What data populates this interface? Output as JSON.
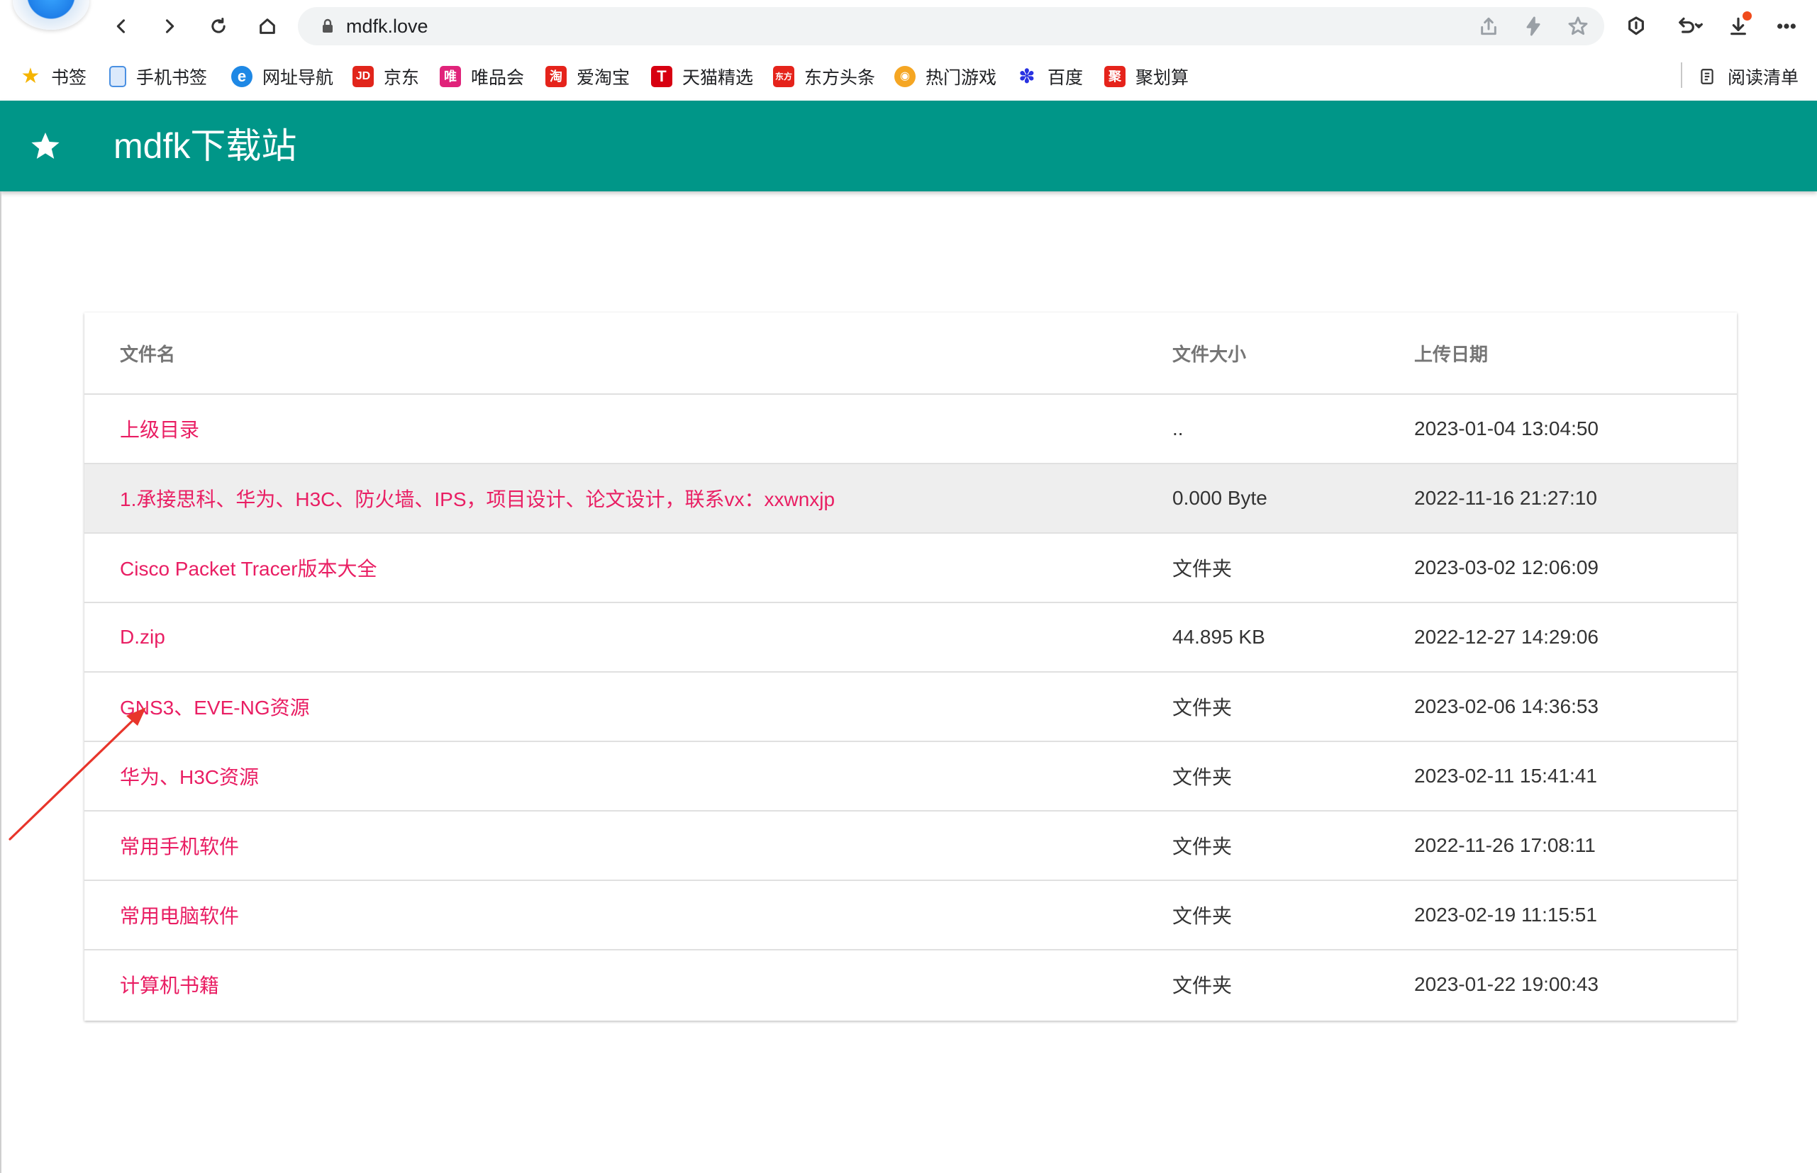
{
  "browser": {
    "url": "mdfk.love"
  },
  "bookmarks": [
    {
      "label": "书签",
      "icon": "star-icon",
      "color": "#f5b400",
      "glyph": "★"
    },
    {
      "label": "手机书签",
      "icon": "phone-icon",
      "color": "#4a90e2",
      "glyph": "▯"
    },
    {
      "label": "网址导航",
      "icon": "e-icon",
      "color": "#1e88e5",
      "glyph": "e"
    },
    {
      "label": "京东",
      "icon": "jd-icon",
      "color": "#e1251b",
      "glyph": "JD"
    },
    {
      "label": "唯品会",
      "icon": "vip-icon",
      "color": "#e0237a",
      "glyph": "唯"
    },
    {
      "label": "爱淘宝",
      "icon": "taobao-icon",
      "color": "#e5231b",
      "glyph": "淘"
    },
    {
      "label": "天猫精选",
      "icon": "tmall-icon",
      "color": "#d70011",
      "glyph": "T"
    },
    {
      "label": "东方头条",
      "icon": "toutiao-icon",
      "color": "#e5231b",
      "glyph": "东方"
    },
    {
      "label": "热门游戏",
      "icon": "game-icon",
      "color": "#f5a623",
      "glyph": "◉"
    },
    {
      "label": "百度",
      "icon": "baidu-paw-icon",
      "color": "#2932e1",
      "glyph": "✽"
    },
    {
      "label": "聚划算",
      "icon": "juhuasuan-icon",
      "color": "#e5231b",
      "glyph": "聚"
    }
  ],
  "reading_list": {
    "label": "阅读清单"
  },
  "site": {
    "title": "mdfk下载站",
    "header_color": "#009688"
  },
  "table": {
    "columns": [
      "文件名",
      "文件大小",
      "上传日期"
    ],
    "rows": [
      {
        "name": "上级目录",
        "size": "..",
        "date": "2023-01-04 13:04:50"
      },
      {
        "name": "1.承接思科、华为、H3C、防火墙、IPS，项目设计、论文设计，联系vx：xxwnxjp",
        "size": "0.000 Byte",
        "date": "2022-11-16 21:27:10"
      },
      {
        "name": "Cisco Packet Tracer版本大全",
        "size": "文件夹",
        "date": "2023-03-02 12:06:09"
      },
      {
        "name": "D.zip",
        "size": "44.895 KB",
        "date": "2022-12-27 14:29:06"
      },
      {
        "name": "GNS3、EVE-NG资源",
        "size": "文件夹",
        "date": "2023-02-06 14:36:53"
      },
      {
        "name": "华为、H3C资源",
        "size": "文件夹",
        "date": "2023-02-11 15:41:41"
      },
      {
        "name": "常用手机软件",
        "size": "文件夹",
        "date": "2022-11-26 17:08:11"
      },
      {
        "name": "常用电脑软件",
        "size": "文件夹",
        "date": "2023-02-19 11:15:51"
      },
      {
        "name": "计算机书籍",
        "size": "文件夹",
        "date": "2023-01-22 19:00:43"
      }
    ],
    "link_color": "#e91e63"
  }
}
